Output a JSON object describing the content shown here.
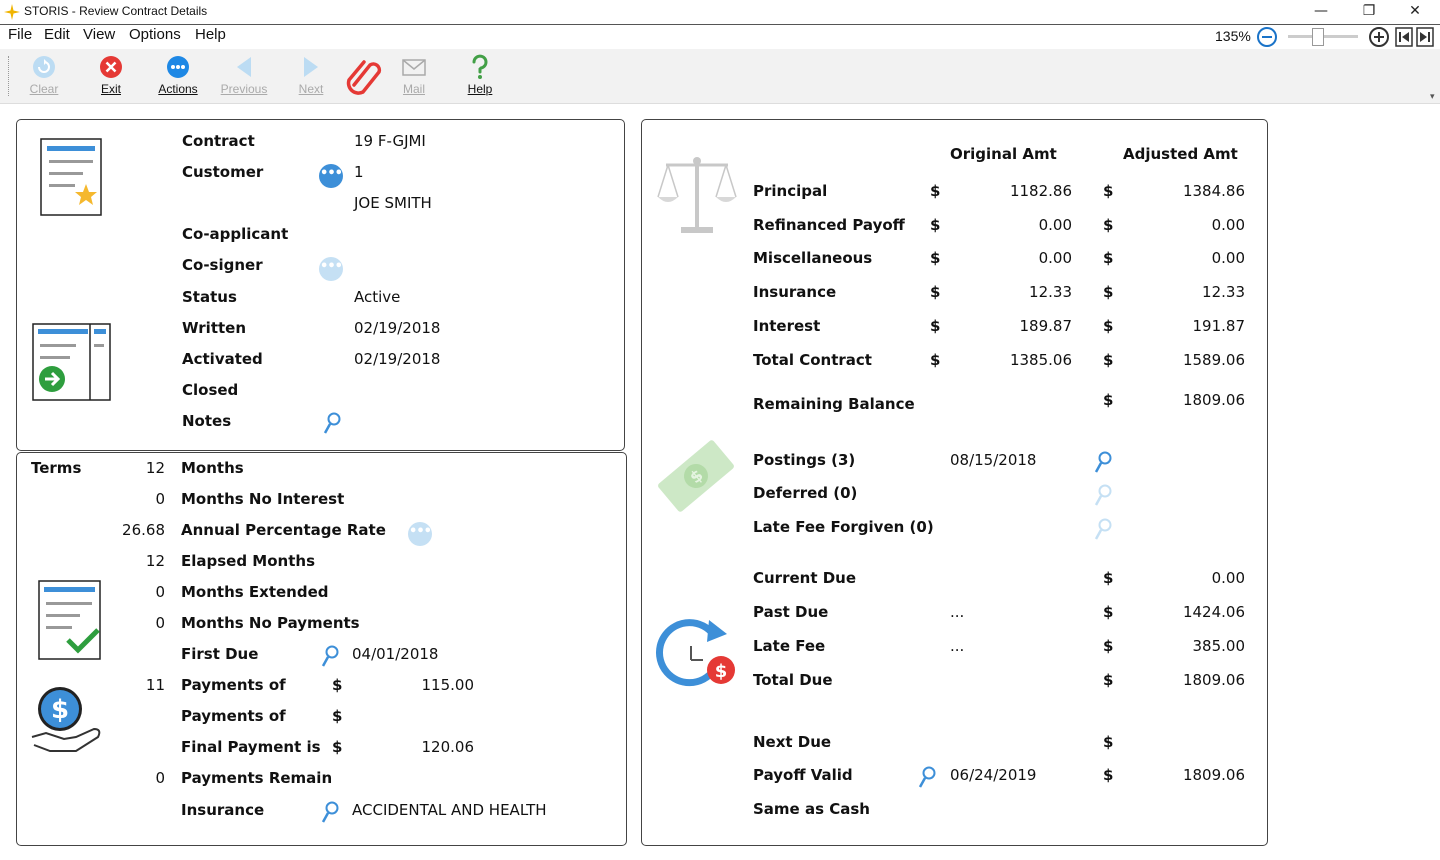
{
  "window": {
    "title": "STORIS - Review Contract Details"
  },
  "menu": {
    "file": "File",
    "edit": "Edit",
    "view": "View",
    "options": "Options",
    "help": "Help"
  },
  "zoom": {
    "level": "135%"
  },
  "toolbar": {
    "clear": "Clear",
    "exit": "Exit",
    "actions": "Actions",
    "previous": "Previous",
    "next": "Next",
    "mail": "Mail",
    "help": "Help"
  },
  "contract": {
    "contract_label": "Contract",
    "contract_value": "19  F-GJMI",
    "customer_label": "Customer",
    "customer_number": "1",
    "customer_name": "JOE SMITH",
    "coapplicant_label": "Co-applicant",
    "cosigner_label": "Co-signer",
    "status_label": "Status",
    "status_value": "Active",
    "written_label": "Written",
    "written_value": "02/19/2018",
    "activated_label": "Activated",
    "activated_value": "02/19/2018",
    "closed_label": "Closed",
    "notes_label": "Notes"
  },
  "terms": {
    "terms_label": "Terms",
    "months_value": "12",
    "months_label": "Months",
    "no_interest_value": "0",
    "no_interest_label": "Months No Interest",
    "apr_value": "26.68",
    "apr_label": "Annual Percentage Rate",
    "elapsed_value": "12",
    "elapsed_label": "Elapsed Months",
    "extended_value": "0",
    "extended_label": "Months Extended",
    "no_payments_value": "0",
    "no_payments_label": "Months No Payments",
    "first_due_label": "First Due",
    "first_due_value": "04/01/2018",
    "payments1_count": "11",
    "payments1_label": "Payments of",
    "payments1_cur": "$",
    "payments1_amount": "115.00",
    "payments2_label": "Payments of",
    "payments2_cur": "$",
    "final_label": "Final Payment is",
    "final_cur": "$",
    "final_amount": "120.06",
    "remain_value": "0",
    "remain_label": "Payments Remain",
    "insurance_label": "Insurance",
    "insurance_value": "ACCIDENTAL AND HEALTH"
  },
  "amounts": {
    "original_header": "Original Amt",
    "adjusted_header": "Adjusted Amt",
    "currency": "$",
    "rows": [
      {
        "label": "Principal",
        "original": "1182.86",
        "adjusted": "1384.86"
      },
      {
        "label": "Refinanced Payoff",
        "original": "0.00",
        "adjusted": "0.00"
      },
      {
        "label": "Miscellaneous",
        "original": "0.00",
        "adjusted": "0.00"
      },
      {
        "label": "Insurance",
        "original": "12.33",
        "adjusted": "12.33"
      },
      {
        "label": "Interest",
        "original": "189.87",
        "adjusted": "191.87"
      },
      {
        "label": "Total Contract",
        "original": "1385.06",
        "adjusted": "1589.06"
      }
    ],
    "remaining_label": "Remaining Balance",
    "remaining_value": "1809.06"
  },
  "postings": {
    "postings_label": "Postings (3)",
    "postings_date": "08/15/2018",
    "deferred_label": "Deferred (0)",
    "late_fee_forgiven_label": "Late Fee Forgiven (0)"
  },
  "due": {
    "current_label": "Current Due",
    "current_value": "0.00",
    "past_label": "Past Due",
    "past_more": "...",
    "past_value": "1424.06",
    "late_label": "Late Fee",
    "late_more": "...",
    "late_value": "385.00",
    "total_label": "Total Due",
    "total_value": "1809.06",
    "next_label": "Next Due",
    "payoff_label": "Payoff Valid",
    "payoff_date": "06/24/2019",
    "payoff_value": "1809.06",
    "same_as_cash_label": "Same as Cash"
  }
}
